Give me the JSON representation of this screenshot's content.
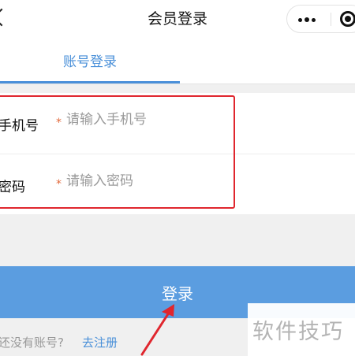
{
  "navbar": {
    "title": "会员登录",
    "back_icon": "chevron-left-icon",
    "more_icon": "more-dots-icon",
    "close_icon": "target-icon"
  },
  "tabs": [
    {
      "label": "账号登录",
      "active": true
    }
  ],
  "form": {
    "phone": {
      "label": "手机号",
      "required_mark": "*",
      "placeholder": "请输入手机号",
      "value": ""
    },
    "password": {
      "label": "密码",
      "required_mark": "*",
      "placeholder": "请输入密码",
      "value": ""
    }
  },
  "login_button": {
    "label": "登录"
  },
  "register": {
    "prompt": "还没有账号?",
    "link": "去注册"
  },
  "watermark": "软件技巧",
  "colors": {
    "accent": "#4a90d9",
    "button": "#5b9de0",
    "highlight": "#e0262e",
    "required": "#e26a3c"
  }
}
